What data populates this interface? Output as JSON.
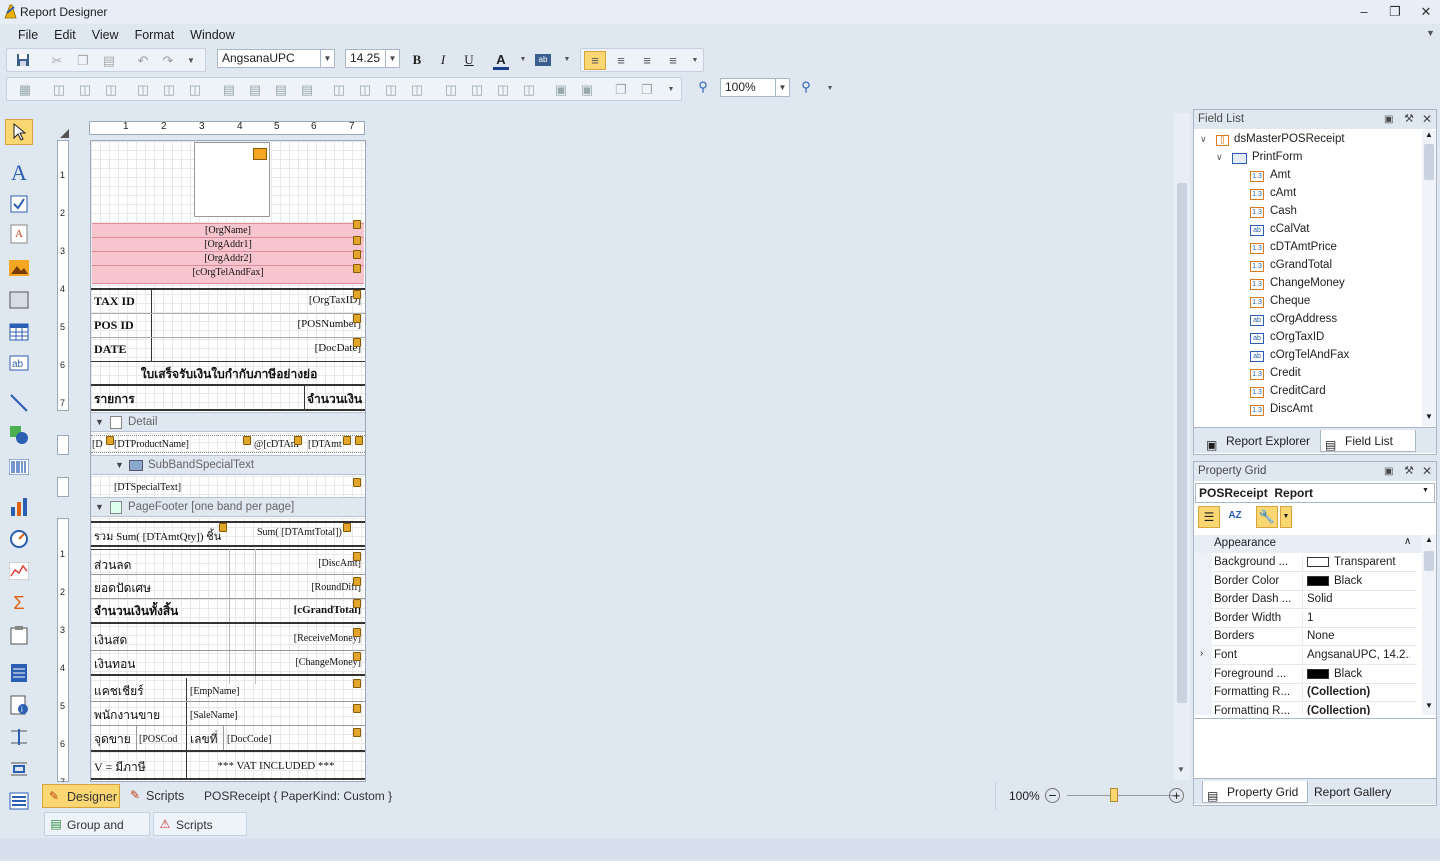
{
  "window": {
    "title": "Report Designer"
  },
  "menu": [
    "File",
    "Edit",
    "View",
    "Format",
    "Window"
  ],
  "toolbar": {
    "font_name": "AngsanaUPC",
    "font_size": "14.25",
    "zoom": "100%"
  },
  "report": {
    "header_fields": [
      "[OrgName]",
      "[OrgAddr1]",
      "[OrgAddr2]",
      "[cOrgTelAndFax]"
    ],
    "rows": [
      {
        "label": "TAX ID",
        "value": "[OrgTaxID]"
      },
      {
        "label": "POS ID",
        "value": "[POSNumber]"
      },
      {
        "label": "DATE",
        "value": "[DocDate]"
      }
    ],
    "thai_title": "ใบเสร็จรับเงินใบกำกับภาษีอย่างย่อ",
    "col_item": "รายการ",
    "col_amount": "จำนวนเงิน",
    "detail_band": "Detail",
    "detail_cells": [
      "[D",
      "[DTProductName]",
      "@[cDTAm",
      "[DTAmt"
    ],
    "subband": "SubBandSpecialText",
    "special_text": "[DTSpecialText]",
    "footer_band": "PageFooter [one band per page]",
    "sum_qty": "รวม Sum( [DTAmtQty]) ชิ้น",
    "sum_total": "Sum( [DTAmtTotal])",
    "footer_rows": [
      {
        "label": "ส่วนลด",
        "value": "[DiscAmt]"
      },
      {
        "label": "ยอดปัดเศษ",
        "value": "[RoundDiff]"
      },
      {
        "label": "จำนวนเงินทั้งสิ้น",
        "value": "[cGrandTotal]"
      },
      {
        "label": "เงินสด",
        "value": "[ReceiveMoney]"
      },
      {
        "label": "เงินทอน",
        "value": "[ChangeMoney]"
      },
      {
        "label": "แคชเชียร์",
        "value": "[EmpName]"
      },
      {
        "label": "พนักงานขาย",
        "value": "[SaleName]"
      }
    ],
    "pos_label": "จุดขาย",
    "pos_code": "[POSCod",
    "doc_label": "เลขที่",
    "doc_code": "[DocCode]",
    "vat_label": "V = มีภาษี",
    "vat_text": "*** VAT INCLUDED ***"
  },
  "ruler_top": [
    "1",
    "2",
    "3",
    "4",
    "5",
    "6",
    "7"
  ],
  "ruler_left_a": [
    "1",
    "2",
    "3",
    "4",
    "5",
    "6",
    "7"
  ],
  "ruler_left_b": [
    "1",
    "2",
    "3",
    "4",
    "5",
    "6",
    "7"
  ],
  "field_list": {
    "title": "Field List",
    "root": "dsMasterPOSReceipt",
    "table": "PrintForm",
    "fields": [
      {
        "name": "Amt",
        "type": "1.3"
      },
      {
        "name": "cAmt",
        "type": "1.3"
      },
      {
        "name": "Cash",
        "type": "1.3"
      },
      {
        "name": "cCalVat",
        "type": "ab"
      },
      {
        "name": "cDTAmtPrice",
        "type": "1.3"
      },
      {
        "name": "cGrandTotal",
        "type": "1.3"
      },
      {
        "name": "ChangeMoney",
        "type": "1.3"
      },
      {
        "name": "Cheque",
        "type": "1.3"
      },
      {
        "name": "cOrgAddress",
        "type": "ab"
      },
      {
        "name": "cOrgTaxID",
        "type": "ab"
      },
      {
        "name": "cOrgTelAndFax",
        "type": "ab"
      },
      {
        "name": "Credit",
        "type": "1.3"
      },
      {
        "name": "CreditCard",
        "type": "1.3"
      },
      {
        "name": "DiscAmt",
        "type": "1.3"
      }
    ],
    "tabs": [
      "Report Explorer",
      "Field List"
    ]
  },
  "property_grid": {
    "title": "Property Grid",
    "object": "POSReceipt  Report",
    "category": "Appearance",
    "rows": [
      {
        "name": "Background ...",
        "value": "Transparent",
        "swatch": "#ffffff"
      },
      {
        "name": "Border Color",
        "value": "Black",
        "swatch": "#000000"
      },
      {
        "name": "Border Dash ...",
        "value": "Solid"
      },
      {
        "name": "Border Width",
        "value": "1"
      },
      {
        "name": "Borders",
        "value": "None"
      },
      {
        "name": "Font",
        "value": "AngsanaUPC, 14.2..."
      },
      {
        "name": "Foreground ...",
        "value": "Black",
        "swatch": "#000000"
      },
      {
        "name": "Formatting R...",
        "value": "(Collection)"
      },
      {
        "name": "Formatting R...",
        "value": "(Collection)"
      }
    ],
    "tabs": [
      "Property Grid",
      "Report Gallery"
    ]
  },
  "status": {
    "designer": "Designer",
    "scripts": "Scripts",
    "info": "POSReceipt { PaperKind: Custom }",
    "zoom": "100%"
  },
  "bottom_tabs": [
    "Group and Sort",
    "Scripts Errors"
  ]
}
